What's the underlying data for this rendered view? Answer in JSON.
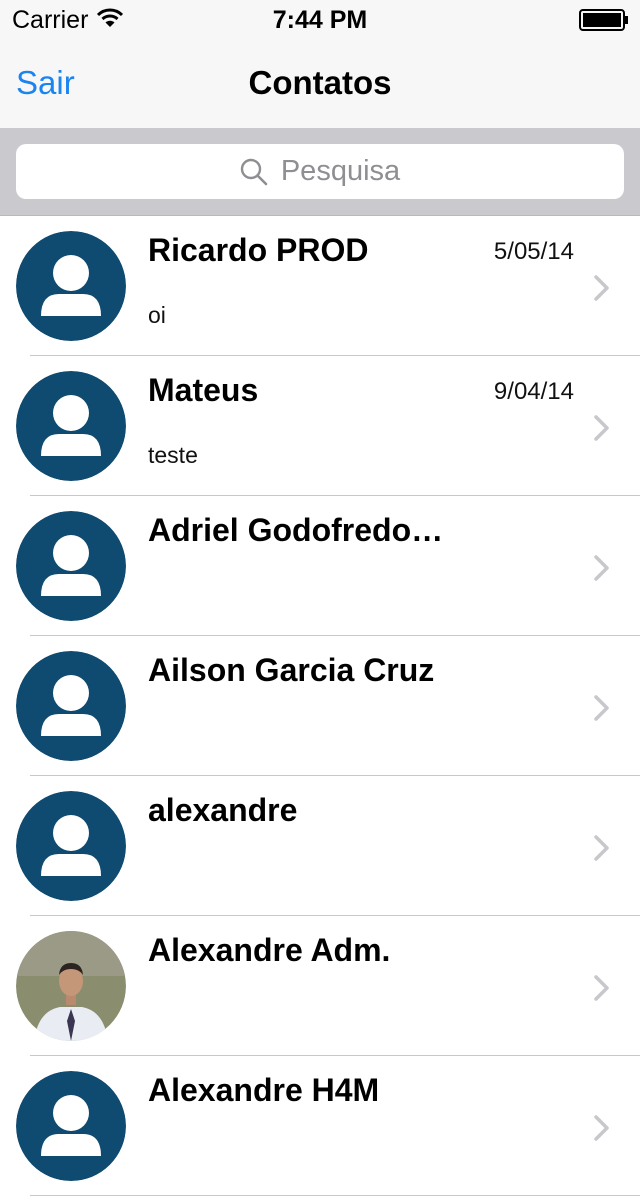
{
  "status_bar": {
    "carrier": "Carrier",
    "time": "7:44 PM"
  },
  "nav": {
    "back_label": "Sair",
    "title": "Contatos"
  },
  "search": {
    "placeholder": "Pesquisa"
  },
  "contacts": [
    {
      "name": "Ricardo PROD",
      "date": "5/05/14",
      "preview": "oi",
      "avatar": "default-person-icon"
    },
    {
      "name": "Mateus",
      "date": "9/04/14",
      "preview": "teste",
      "avatar": "default-person-icon"
    },
    {
      "name": "Adriel Godofredo…",
      "date": "",
      "preview": "",
      "avatar": "default-person-icon"
    },
    {
      "name": "Ailson Garcia Cruz",
      "date": "",
      "preview": "",
      "avatar": "default-person-icon"
    },
    {
      "name": "alexandre",
      "date": "",
      "preview": "",
      "avatar": "default-person-icon"
    },
    {
      "name": "Alexandre Adm.",
      "date": "",
      "preview": "",
      "avatar": "profile-photo"
    },
    {
      "name": "Alexandre H4M",
      "date": "",
      "preview": "",
      "avatar": "default-person-icon"
    }
  ],
  "colors": {
    "tint": "#1a84f0",
    "avatar_bg": "#0f4a70",
    "separator": "#c8c7cc",
    "search_bar_bg": "#c9c9ce"
  }
}
